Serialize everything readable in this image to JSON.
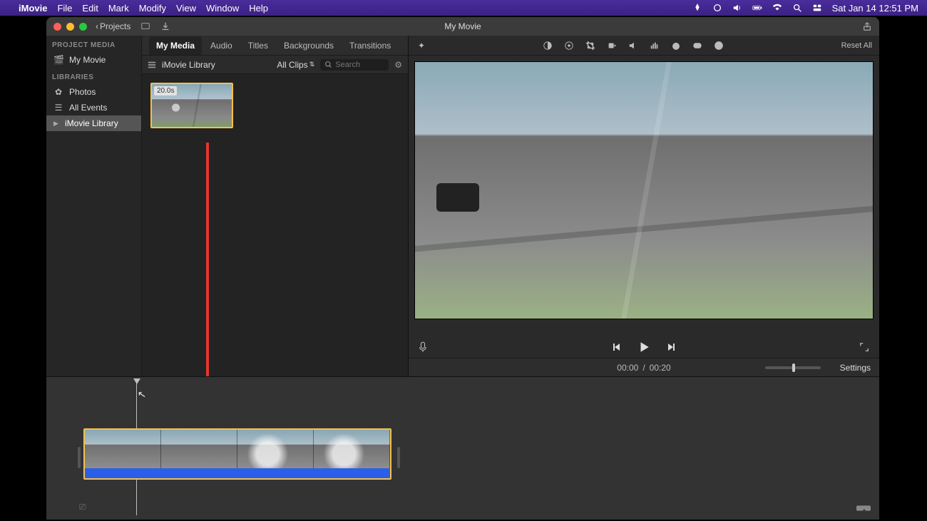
{
  "menubar": {
    "app": "iMovie",
    "items": [
      "File",
      "Edit",
      "Mark",
      "Modify",
      "View",
      "Window",
      "Help"
    ],
    "clock": "Sat Jan 14  12:51 PM"
  },
  "window": {
    "title": "My Movie",
    "back_label": "Projects"
  },
  "sidebar": {
    "section1": "PROJECT MEDIA",
    "project": "My Movie",
    "section2": "LIBRARIES",
    "items": [
      "Photos",
      "All Events",
      "iMovie Library"
    ]
  },
  "browser": {
    "tabs": [
      "My Media",
      "Audio",
      "Titles",
      "Backgrounds",
      "Transitions"
    ],
    "library_name": "iMovie Library",
    "filter": "All Clips",
    "search_placeholder": "Search",
    "clip_duration": "20.0s"
  },
  "toolbar": {
    "reset": "Reset All"
  },
  "player": {
    "current": "00:00",
    "sep": "/",
    "total": "00:20",
    "settings": "Settings"
  }
}
